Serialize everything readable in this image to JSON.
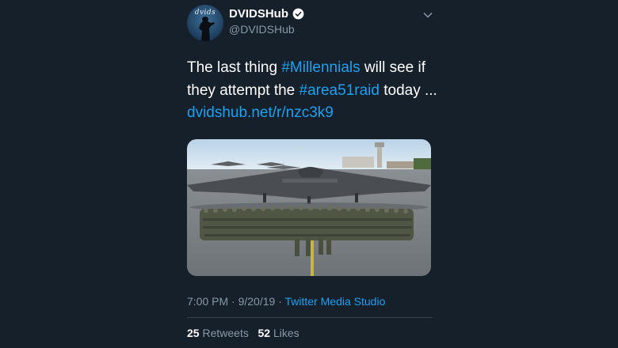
{
  "tweet": {
    "avatar_text": "dvids",
    "display_name": "DVIDSHub",
    "handle": "@DVIDSHub",
    "text_part1": "The last thing ",
    "hashtag1": "#Millennials",
    "text_part2": " will see if they attempt the ",
    "hashtag2": "#area51raid",
    "text_part3": " today ...",
    "link": "dvidshub.net/r/nzc3k9",
    "time": "7:00 PM",
    "date": "9/20/19",
    "separator": "·",
    "source": "Twitter Media Studio",
    "retweets_count": "25",
    "retweets_label": "Retweets",
    "likes_count": "52",
    "likes_label": "Likes"
  },
  "colors": {
    "background": "#15202b",
    "link": "#1da1f2",
    "muted": "#8899a6"
  },
  "icons": {
    "verified": "verified-badge-icon",
    "menu": "chevron-down-icon"
  }
}
